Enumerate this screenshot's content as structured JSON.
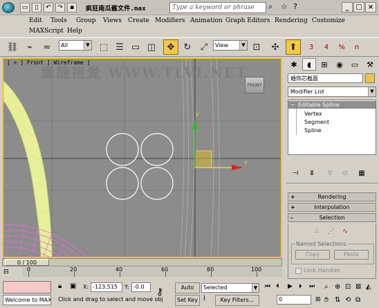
{
  "window": {
    "title": "疯狂南瓜酱文件.max",
    "search_placeholder": "Type a keyword or phrase",
    "controls": [
      "_",
      "□",
      "×"
    ]
  },
  "menu": {
    "row1": [
      "Edit",
      "Tools",
      "Group",
      "Views",
      "Create",
      "Modifiers",
      "Animation",
      "Graph Editors",
      "Rendering",
      "Customize"
    ],
    "row2": [
      "MAXScript",
      "Help"
    ]
  },
  "toolbar": {
    "selection_filter": "All",
    "ref_coord": "View",
    "snap_labels": [
      "3",
      "4",
      "%",
      "n"
    ]
  },
  "viewport": {
    "label": "[ + ] Front ] Wireframe ]",
    "watermark": "鷹龍視覺 WWW.TLVI.NET",
    "viewcube_label": "FRONT",
    "axis_y": "y",
    "axis_x": "x"
  },
  "command_panel": {
    "object_name": "婚饰芯截面",
    "object_color": "#e8c650",
    "modifier_list": "Modifier List",
    "stack_top": "Editable Spline",
    "stack_subs": [
      "Vertex",
      "Segment",
      "Spline"
    ],
    "rollouts": [
      {
        "sign": "+",
        "label": "Rendering"
      },
      {
        "sign": "+",
        "label": "Interpolation"
      },
      {
        "sign": "-",
        "label": "Selection"
      }
    ],
    "named_selections_label": "Named Selections:",
    "copy_label": "Copy",
    "paste_label": "Paste",
    "lock_handles_label": "Lock Handles"
  },
  "timeline": {
    "frame": "0 / 100",
    "ticks": [
      "0",
      "20",
      "40",
      "60",
      "80",
      "100"
    ]
  },
  "status": {
    "maxscript_output": "Welcome to MAX",
    "x_label": "X:",
    "x_value": "-123.515",
    "y_label": "Y:",
    "y_value": "-0.0",
    "prompt": "Click and drag to select and move obj",
    "auto_key": "Auto Key",
    "set_key": "Set Key",
    "selected": "Selected",
    "key_filters": "Key Filters...",
    "frame_field": "0"
  }
}
